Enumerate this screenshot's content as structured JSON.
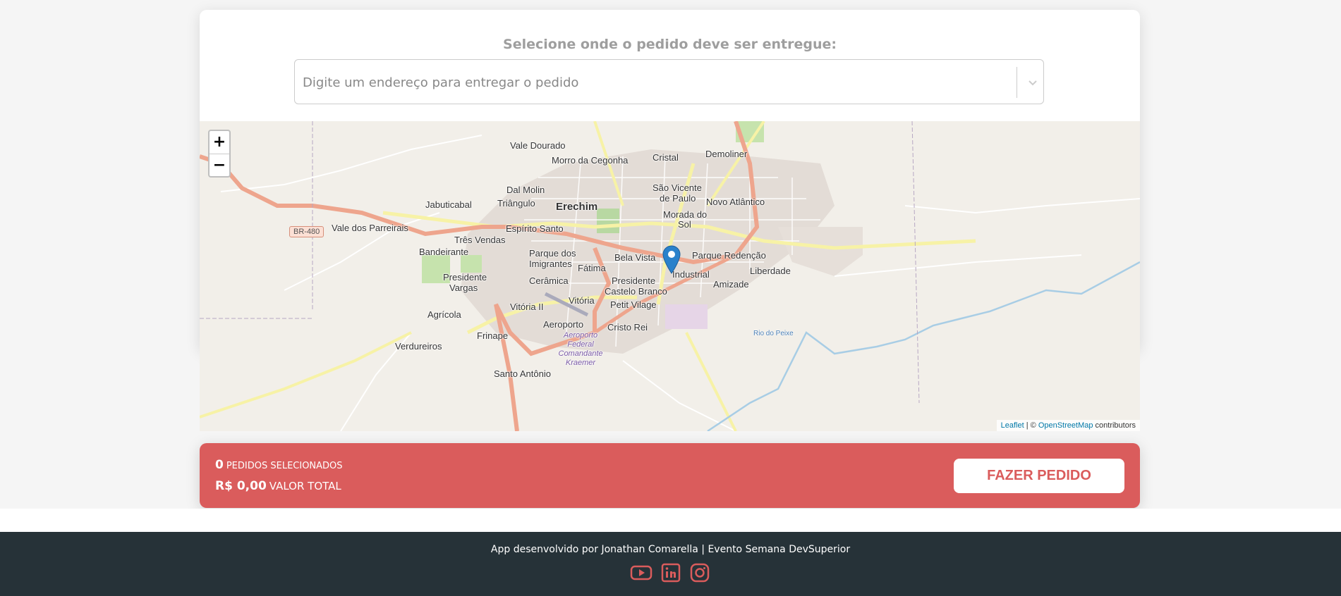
{
  "card": {
    "title": "Selecione onde o pedido deve ser entregue:",
    "search_placeholder": "Digite um endereço para entregar o pedido"
  },
  "map": {
    "zoom_in": "+",
    "zoom_out": "−",
    "road_badge": "BR-480",
    "attribution": {
      "leaflet": "Leaflet",
      "separator": " | © ",
      "osm": "OpenStreetMap",
      "suffix": " contributors"
    },
    "labels": {
      "vale_dourado": "Vale Dourado",
      "morro_cegonha": "Morro da Cegonha",
      "cristal": "Cristal",
      "demoliner": "Demoliner",
      "dal_molin": "Dal Molin",
      "sao_vicente_1": "São Vicente",
      "sao_vicente_2": "de Paulo",
      "triangulo": "Triângulo",
      "erechim": "Erechim",
      "novo_atlantico": "Novo Atlântico",
      "morada_1": "Morada do",
      "morada_2": "Sol",
      "jabuticabal": "Jabuticabal",
      "vale_parreirais": "Vale dos Parreirais",
      "espirito_santo": "Espírito Santo",
      "tres_vendas": "Três Vendas",
      "bandeirante": "Bandeirante",
      "parque_imig_1": "Parque dos",
      "parque_imig_2": "Imigrantes",
      "bela_vista": "Bela Vista",
      "parque_redencao": "Parque Redenção",
      "fatima": "Fátima",
      "industrial": "Industrial",
      "liberdade": "Liberdade",
      "presidente_vargas_1": "Presidente",
      "presidente_vargas_2": "Vargas",
      "ceramica": "Cerâmica",
      "presidente": "Presidente",
      "amizade": "Amizade",
      "castelo_branco": "Castelo Branco",
      "vitoria": "Vitória",
      "vitoria_ii": "Vitória II",
      "petit_vilage": "Petit Vilage",
      "agricola": "Agrícola",
      "aeroporto": "Aeroporto",
      "cristo_rei": "Cristo Rei",
      "frinape": "Frinape",
      "verdureiros": "Verdureiros",
      "santo_antonio": "Santo Antônio",
      "rio_do_peixe": "Rio do Peixe",
      "airport_name": "Aeroporto Federal Comandante Kraemer"
    }
  },
  "summary": {
    "count": "0",
    "count_label": "Pedidos selecionados",
    "total": "R$ 0,00",
    "total_label": "Valor total",
    "button_label": "FAZER PEDIDO"
  },
  "footer": {
    "text": "App desenvolvido por Jonathan Comarella | Evento Semana DevSuperior",
    "icons": [
      "youtube-icon",
      "linkedin-icon",
      "instagram-icon"
    ]
  },
  "colors": {
    "accent": "#da5c5c",
    "footer_bg": "#263238",
    "page_bg": "#f5f5f5",
    "marker": "#2a81cb"
  }
}
